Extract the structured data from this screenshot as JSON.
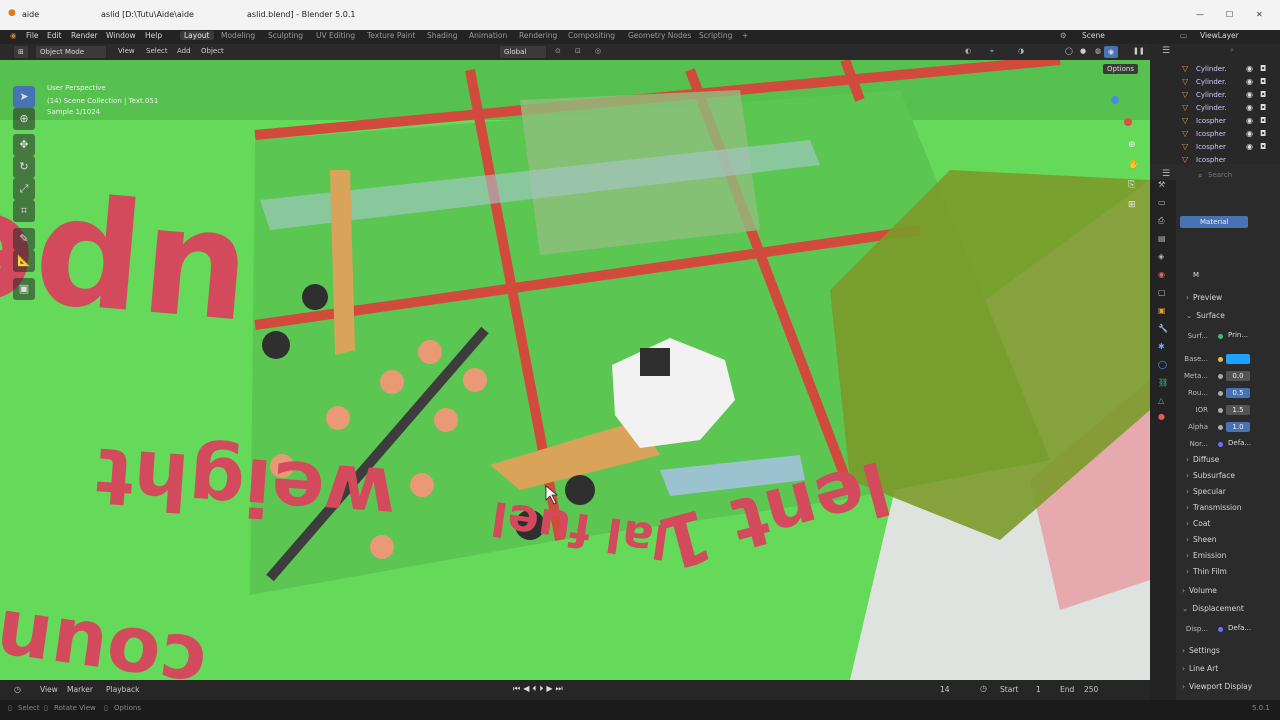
{
  "titlebar": {
    "app_tab": "aide",
    "path_tab": "aslid [D:\\Tutu\\Aide\\aide",
    "window_title": "aslid.blend] - Blender 5.0.1",
    "min": "—",
    "max": "☐",
    "close": "✕"
  },
  "menu": {
    "items": [
      "File",
      "Edit",
      "Render",
      "Window",
      "Help"
    ],
    "workspaces": [
      "Layout",
      "Modeling",
      "Sculpting",
      "UV Editing",
      "Texture Paint",
      "Shading",
      "Animation",
      "Rendering",
      "Compositing",
      "Geometry Nodes",
      "Scripting"
    ],
    "add_workspace": "+",
    "scene_label": "Scene",
    "viewlayer_label": "ViewLayer"
  },
  "header": {
    "mode": "Object Mode",
    "menus": [
      "View",
      "Select",
      "Add",
      "Object"
    ],
    "orientation": "Global",
    "options": "Options"
  },
  "viewport": {
    "info_line1": "User Perspective",
    "info_line2": "(14) Scene Collection | Text.051",
    "info_line3": "Sample 1/1024"
  },
  "outliner": {
    "items": [
      "Cylinder.",
      "Cylinder.",
      "Cylinder.",
      "Cylinder.",
      "Icospher",
      "Icospher",
      "Icospher",
      "Icospher"
    ],
    "search_placeholder": "Search"
  },
  "properties": {
    "material_slot": "Material",
    "mat_short": "M",
    "sections": {
      "preview": "Preview",
      "surface": "Surface",
      "diffuse": "Diffuse",
      "subsurface": "Subsurface",
      "specular": "Specular",
      "transmission": "Transmission",
      "coat": "Coat",
      "sheen": "Sheen",
      "emission": "Emission",
      "thin_film": "Thin Film",
      "volume": "Volume",
      "displacement": "Displacement",
      "settings": "Settings",
      "line_art": "Line Art",
      "viewport_display": "Viewport Display"
    },
    "fields": {
      "surface_label": "Surf...",
      "surface_value": "Prin...",
      "base_label": "Base...",
      "metal_label": "Meta...",
      "metal_value": "0.0",
      "rough_label": "Rou...",
      "rough_value": "0.5",
      "ior_label": "IOR",
      "ior_value": "1.5",
      "alpha_label": "Alpha",
      "alpha_value": "1.0",
      "normal_label": "Nor...",
      "normal_value": "Defa...",
      "disp_label": "Disp...",
      "disp_value": "Defa..."
    },
    "base_color": "#1fa2ff"
  },
  "timeline": {
    "menus": [
      "View",
      "Marker",
      "Playback"
    ],
    "current_frame": "14",
    "start_label": "Start",
    "start_value": "1",
    "end_label": "End",
    "end_value": "250"
  },
  "statusbar": {
    "select": "Select",
    "rotate": "Rotate View",
    "options": "Options",
    "version": "5.0.1"
  },
  "scene_text": {
    "word1": "upensate",
    "word2": "weight",
    "word3": "lal fuel",
    "word4": "lent 1",
    "word5": "count fo"
  }
}
